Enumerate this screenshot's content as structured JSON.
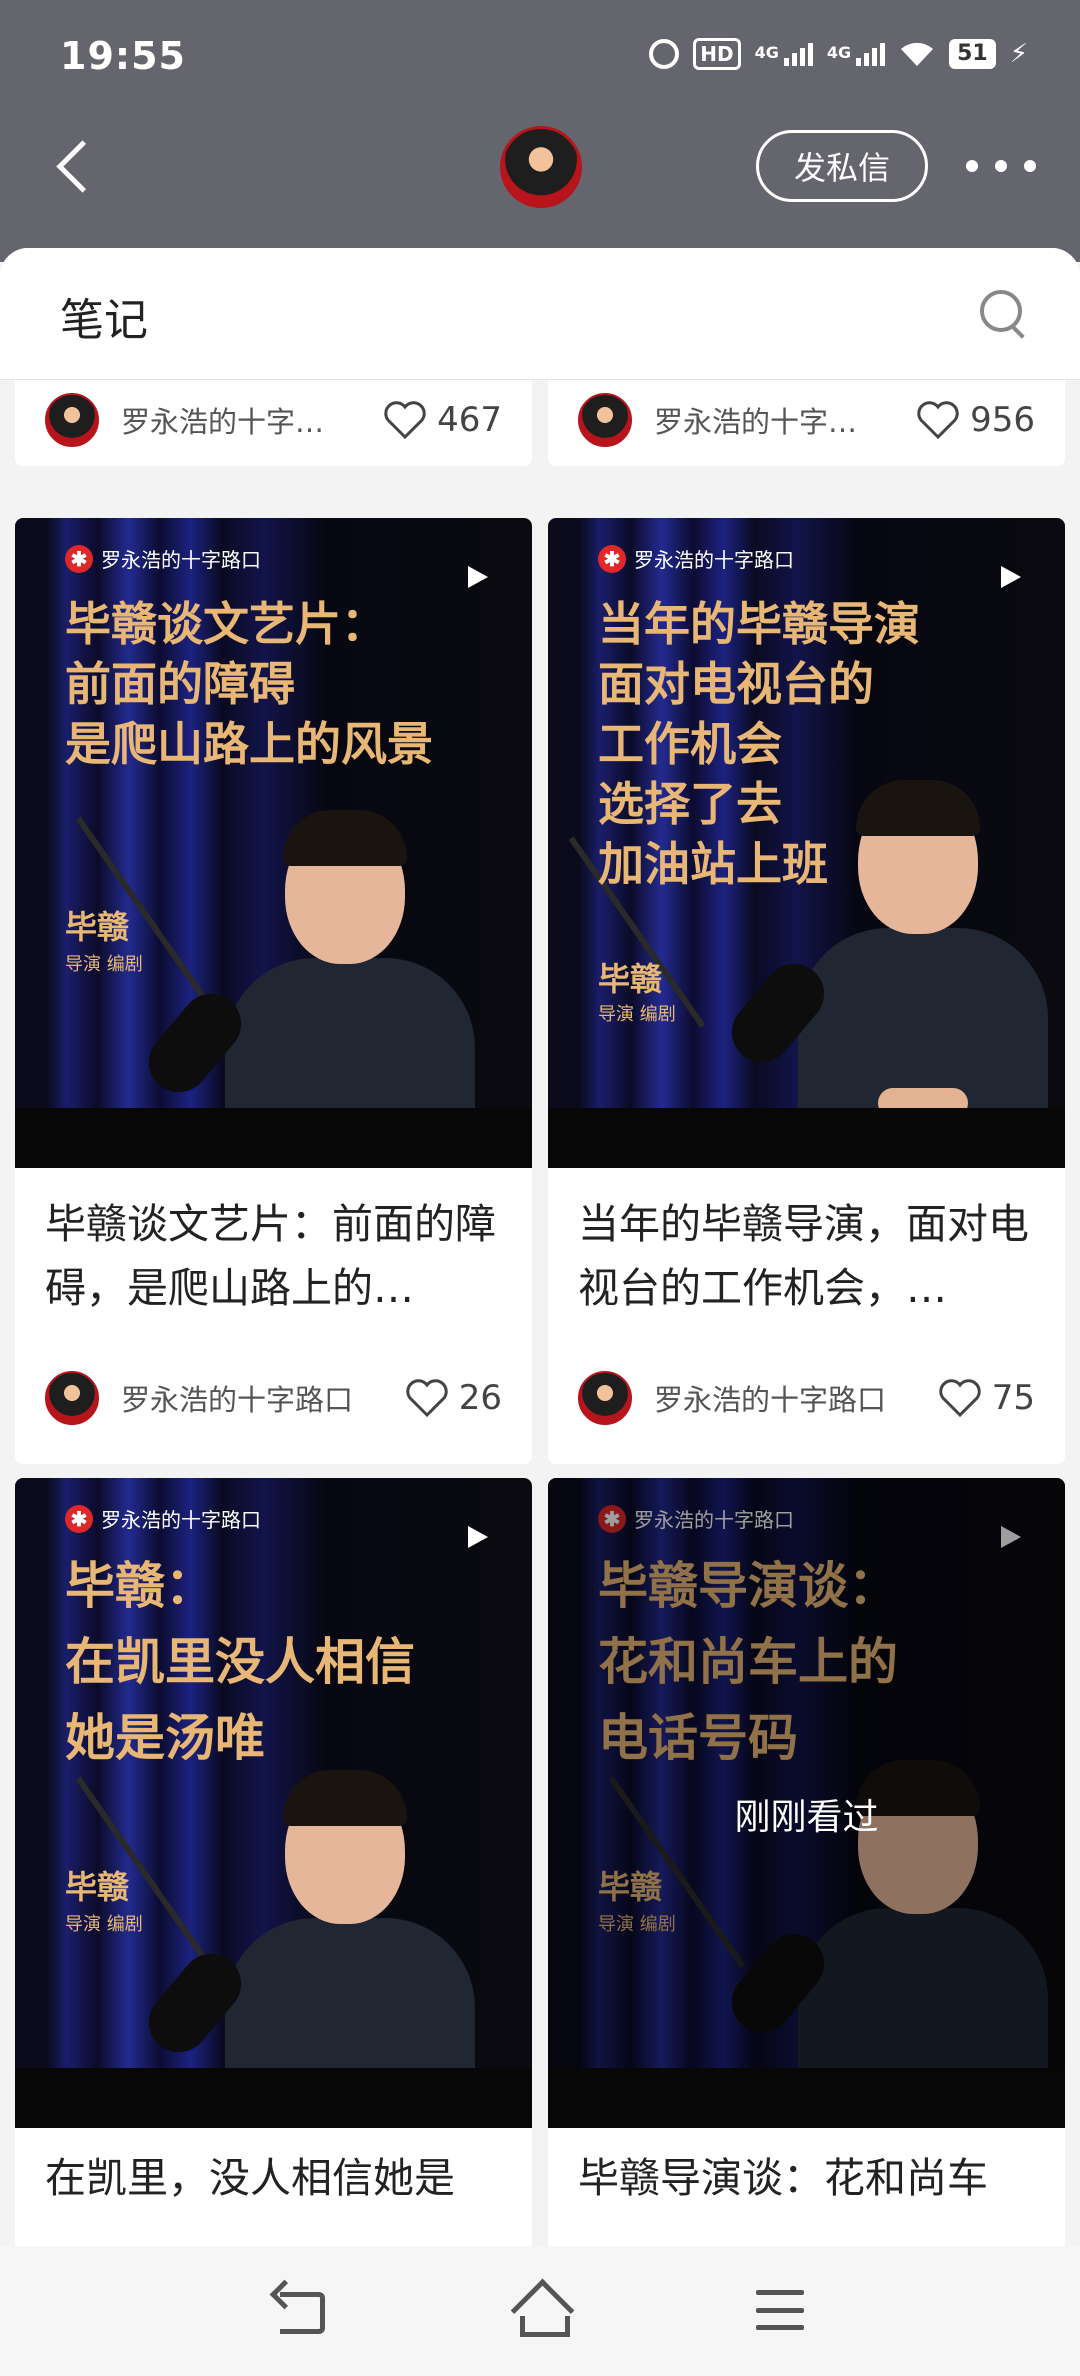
{
  "status_bar": {
    "time": "19:55",
    "hd_label": "HD",
    "net1": "4G",
    "net2": "4G",
    "battery": "51"
  },
  "header": {
    "message_button": "发私信"
  },
  "section": {
    "title": "笔记"
  },
  "top_row": [
    {
      "author": "罗永浩的十字…",
      "likes": "467"
    },
    {
      "author": "罗永浩的十字…",
      "likes": "956"
    }
  ],
  "cards": [
    {
      "brand": "罗永浩的十字路口",
      "headline_lines": [
        "毕赣谈文艺片：",
        "前面的障碍",
        "是爬山路上的风景"
      ],
      "guest_name": "毕赣",
      "guest_role": "导演 编剧",
      "title": "毕赣谈文艺片：前面的障碍，是爬山路上的…",
      "author": "罗永浩的十字路口",
      "likes": "26"
    },
    {
      "brand": "罗永浩的十字路口",
      "headline_lines": [
        "当年的毕赣导演",
        "面对电视台的",
        "工作机会",
        "选择了去",
        "加油站上班"
      ],
      "guest_name": "毕赣",
      "guest_role": "导演 编剧",
      "title": "当年的毕赣导演，面对电视台的工作机会，…",
      "author": "罗永浩的十字路口",
      "likes": "75"
    },
    {
      "brand": "罗永浩的十字路口",
      "headline_lines": [
        "毕赣：",
        "在凯里没人相信",
        "她是汤唯"
      ],
      "guest_name": "毕赣",
      "guest_role": "导演 编剧",
      "title": "在凯里，没人相信她是"
    },
    {
      "brand": "罗永浩的十字路口",
      "headline_lines": [
        "毕赣导演谈：",
        "花和尚车上的",
        "电话号码"
      ],
      "guest_name": "毕赣",
      "guest_role": "导演 编剧",
      "overlay": "刚刚看过",
      "title": "毕赣导演谈：花和尚车"
    }
  ],
  "icons": {
    "status": [
      "alarm-icon",
      "wifi-icon",
      "battery-icon",
      "charging-icon"
    ],
    "header": [
      "back-icon",
      "more-icon"
    ],
    "section": [
      "search-icon"
    ],
    "card": [
      "play-icon",
      "heart-icon"
    ],
    "bottom_nav": [
      "nav-back-icon",
      "nav-home-icon",
      "nav-menu-icon"
    ]
  }
}
